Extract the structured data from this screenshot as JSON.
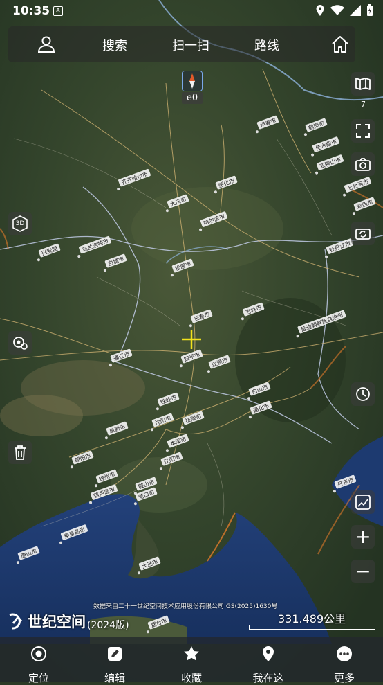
{
  "status": {
    "time": "10:35"
  },
  "topbar": {
    "profile_icon": "user-icon",
    "search_label": "搜索",
    "scan_label": "扫一扫",
    "route_label": "路线",
    "home_icon": "home-icon"
  },
  "compass": {
    "label": "e0"
  },
  "right_controls": {
    "map_layers_icon": "map-book-icon",
    "map_layers_count": "7",
    "fullscreen_icon": "expand-icon",
    "camera_icon": "camera-icon",
    "rotate_icon": "rotate-camera-icon",
    "history_icon": "clock-icon",
    "measure_icon": "map-measure-icon",
    "zoom_in": "+",
    "zoom_out": "−"
  },
  "left_controls": {
    "3d_label": "3D",
    "location_settings_icon": "location-gear-icon",
    "delete_icon": "trash-icon"
  },
  "map": {
    "cities": [
      "伊春市",
      "鹤岗市",
      "佳木斯市",
      "双鸭山市",
      "齐齐哈尔市",
      "大庆市",
      "绥化市",
      "哈尔滨市",
      "七台河市",
      "鸡西市",
      "乌兰浩特市",
      "白城市",
      "松原市",
      "牡丹江市",
      "长春市",
      "吉林市",
      "延边朝鲜族自治州",
      "通辽市",
      "四平市",
      "辽源市",
      "白山市",
      "铁岭市",
      "抚顺市",
      "通化市",
      "阜新市",
      "沈阳市",
      "本溪市",
      "朝阳市",
      "锦州市",
      "辽阳市",
      "鞍山市",
      "葫芦岛市",
      "营口市",
      "丹东市",
      "秦皇岛市",
      "唐山市",
      "大连市",
      "烟台市",
      "兴安盟"
    ],
    "attribution": "数据来自二十一世纪空间技术应用股份有限公司 GS(2025)1630号",
    "brand_name": "世纪空间",
    "brand_edition": "(2024版)",
    "scale_text": "331.489公里",
    "colors": {
      "land": "#3a4a30",
      "sea": "#1d3566",
      "road": "#e8c27a",
      "border": "#b9c4e6"
    }
  },
  "bottom_nav": [
    {
      "label": "定位",
      "icon": "locate-icon"
    },
    {
      "label": "编辑",
      "icon": "edit-icon"
    },
    {
      "label": "收藏",
      "icon": "favorite-star-icon"
    },
    {
      "label": "我在这",
      "icon": "pin-icon"
    },
    {
      "label": "更多",
      "icon": "more-icon"
    }
  ]
}
